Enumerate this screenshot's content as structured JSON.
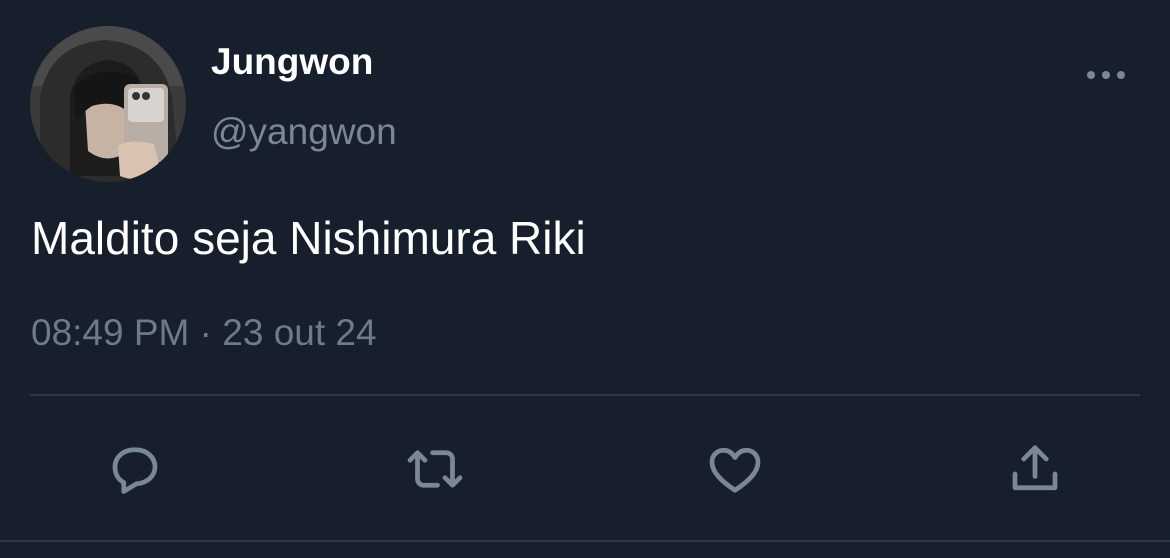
{
  "user": {
    "display_name": "Jungwon",
    "handle": "@yangwon"
  },
  "tweet": {
    "text": "Maldito seja Nishimura Riki",
    "time": "08:49 PM",
    "separator": "·",
    "date": "23 out 24"
  },
  "actions": [
    {
      "icon": "reply-icon"
    },
    {
      "icon": "retweet-icon"
    },
    {
      "icon": "like-icon"
    },
    {
      "icon": "share-icon"
    }
  ],
  "colors": {
    "background": "#161f2b",
    "primary_text": "#ffffff",
    "secondary_text": "#7a8795",
    "icon": "#7a8795",
    "divider": "#2c3845"
  }
}
